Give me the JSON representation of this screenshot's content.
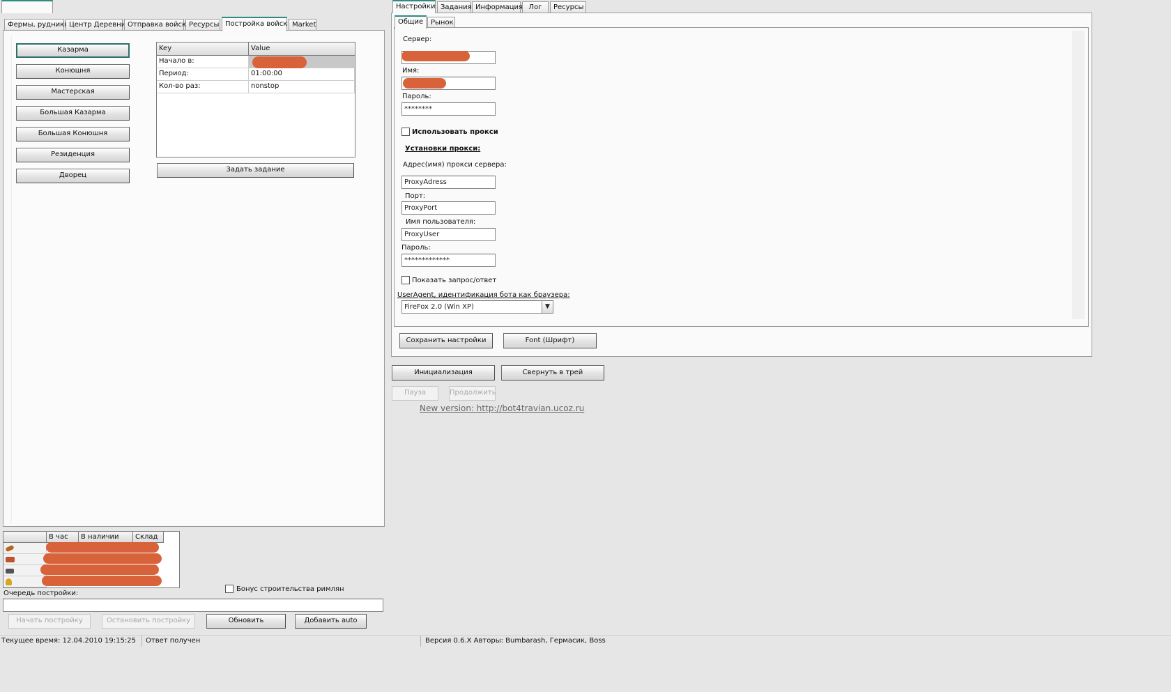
{
  "left_tabs": [
    {
      "label": "Фермы, рудники"
    },
    {
      "label": "Центр Деревни"
    },
    {
      "label": "Отправка войск"
    },
    {
      "label": "Ресурсы"
    },
    {
      "label": "Постройка войск"
    },
    {
      "label": "Market"
    }
  ],
  "buildings": [
    {
      "label": "Казарма"
    },
    {
      "label": "Конюшня"
    },
    {
      "label": "Мастерская"
    },
    {
      "label": "Большая Казарма"
    },
    {
      "label": "Большая Конюшня"
    },
    {
      "label": "Резиденция"
    },
    {
      "label": "Дворец"
    }
  ],
  "task_table": {
    "headers": {
      "key": "Key",
      "value": "Value"
    },
    "rows": [
      {
        "key": "Начало в:",
        "value": ""
      },
      {
        "key": "Период:",
        "value": "01:00:00"
      },
      {
        "key": "Кол-во раз:",
        "value": "nonstop"
      }
    ]
  },
  "set_task_button": "Задать задание",
  "resources_table": {
    "headers": [
      "В час",
      "В наличии",
      "Склад"
    ],
    "icons": [
      "wood-icon",
      "clay-icon",
      "iron-icon",
      "crop-icon"
    ]
  },
  "roman_bonus_label": "Бонус строительства римлян",
  "queue_label": "Очередь постройки:",
  "queue_value": "",
  "bottom_buttons": {
    "start": "Начать постройку",
    "stop": "Остановить постройку",
    "refresh": "Обновить",
    "add_auto": "Добавить auto"
  },
  "right_tabs": [
    {
      "label": "Настройки"
    },
    {
      "label": "Задания"
    },
    {
      "label": "Информация"
    },
    {
      "label": "Лог"
    },
    {
      "label": "Ресурсы"
    }
  ],
  "settings_subtabs": [
    {
      "label": "Общие"
    },
    {
      "label": "Рынок"
    }
  ],
  "settings": {
    "server_label": "Сервер:",
    "server_value": "",
    "name_label": "Имя:",
    "name_value": "",
    "password_label": "Пароль:",
    "password_value": "********",
    "use_proxy_label": "Использовать прокси",
    "proxy_settings_header": "Установки прокси:",
    "proxy_address_label": "Адрес(имя) прокси сервера:",
    "proxy_address_value": "ProxyAdress",
    "port_label": "Порт:",
    "port_value": "ProxyPort",
    "username_label": "Имя пользователя:",
    "username_value": "ProxyUser",
    "proxy_password_label": "Пароль:",
    "proxy_password_value": "*************",
    "show_request_label": "Показать запрос/ответ",
    "useragent_label": "UserAgent, идентификация бота как браузера:",
    "useragent_value": "FireFox 2.0 (Win XP)"
  },
  "save_settings_button": "Сохранить настройки",
  "font_button": "Font (Шрифт)",
  "init_button": "Инициализация",
  "tray_button": "Свернуть в трей",
  "pause_button": "Пауза",
  "continue_button": "Продолжить",
  "new_version_link": "New version: http://bot4travian.ucoz.ru",
  "status_bar": {
    "time": "Текущее время: 12.04.2010 19:15:25",
    "response": "Ответ получен",
    "version": "Версия 0.6.X Авторы: Bumbarash, Гермасик, Boss"
  },
  "colors": {
    "accent": "#2f8a83",
    "redaction": "#d8623a",
    "background": "#e6e6e6"
  }
}
